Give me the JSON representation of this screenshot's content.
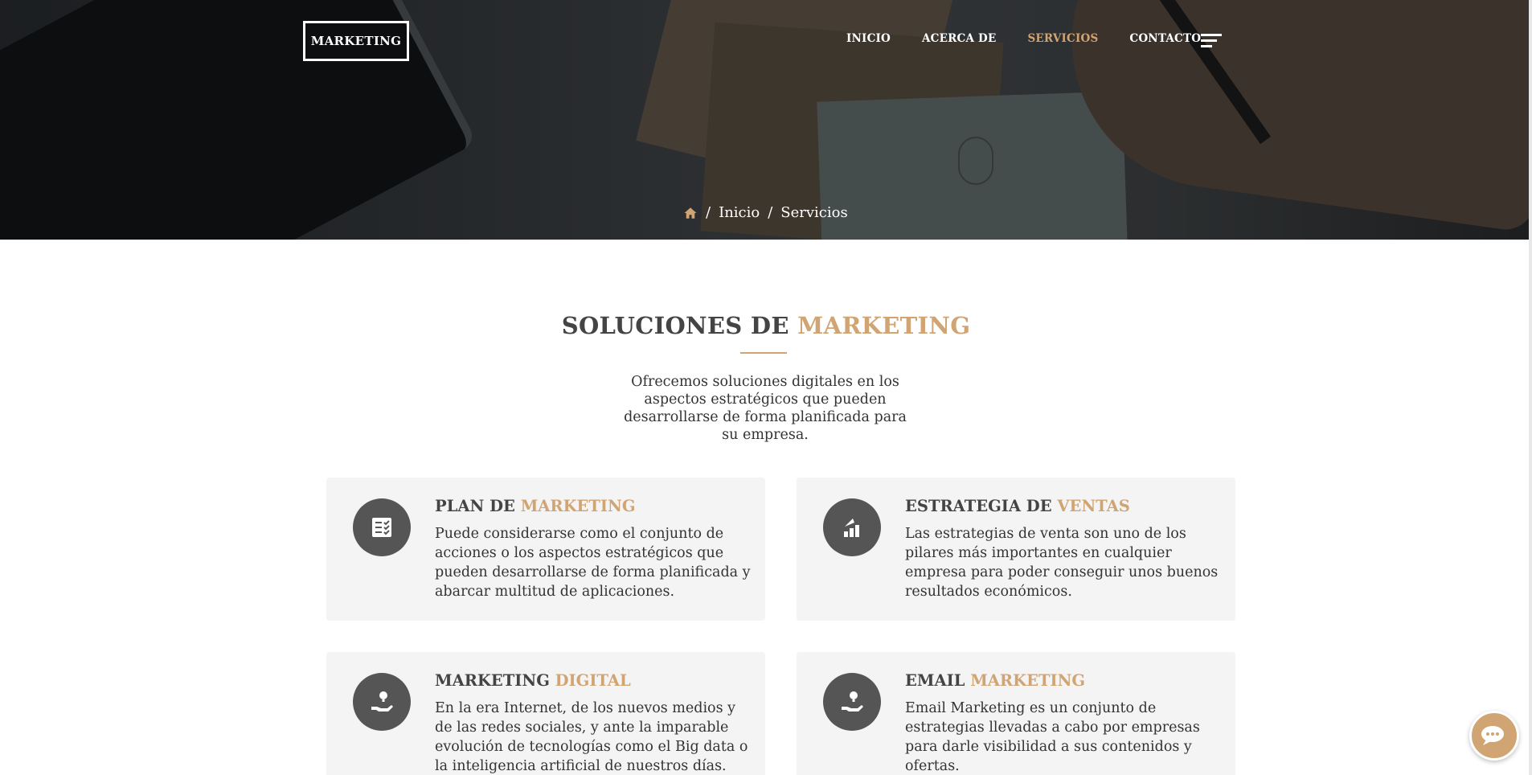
{
  "header": {
    "logo": "MARKETING",
    "nav": [
      {
        "label": "INICIO",
        "active": false
      },
      {
        "label": "ACERCA DE",
        "active": false
      },
      {
        "label": "SERVICIOS",
        "active": true
      },
      {
        "label": "CONTACTO",
        "active": false
      }
    ],
    "menu_icon": "hamburger-icon"
  },
  "breadcrumb": {
    "home_icon": "home-icon",
    "items": [
      "Inicio",
      "Servicios"
    ],
    "separator": "/"
  },
  "section": {
    "title_main": "SOLUCIONES DE",
    "title_accent": "MARKETING",
    "lead": "Ofrecemos soluciones digitales en los aspectos estratégicos que pueden desarrollarse de forma planificada para su empresa."
  },
  "services": [
    {
      "icon": "checklist-icon",
      "title": "PLAN DE",
      "accent": "MARKETING",
      "text": "Puede considerarse como el conjunto de acciones o los aspectos estratégicos que pueden desarrollarse de forma planificada y abarcar multitud de aplicaciones."
    },
    {
      "icon": "growth-chart-icon",
      "title": "ESTRATEGIA DE",
      "accent": "VENTAS",
      "text": "Las estrategias de venta son uno de los pilares más importantes en cualquier empresa para poder conseguir unos buenos resultados económicos."
    },
    {
      "icon": "hand-idea-icon",
      "title": "MARKETING",
      "accent": "DIGITAL",
      "text": "En la era Internet, de los nuevos medios y de las redes sociales, y ante la imparable evolución de tecnologías como el Big data o la inteligencia artificial de nuestros días."
    },
    {
      "icon": "hand-idea-icon",
      "title": "EMAIL",
      "accent": "MARKETING",
      "text": "Email Marketing es un conjunto de estrategias llevadas a cabo por empresas para darle visibilidad a sus contenidos y ofertas."
    }
  ],
  "chat_icon": "chat-bubble-icon",
  "colors": {
    "accent": "#d0a473",
    "text": "#333333",
    "card_bg": "#f4f4f4",
    "icon_bg": "#555555"
  }
}
